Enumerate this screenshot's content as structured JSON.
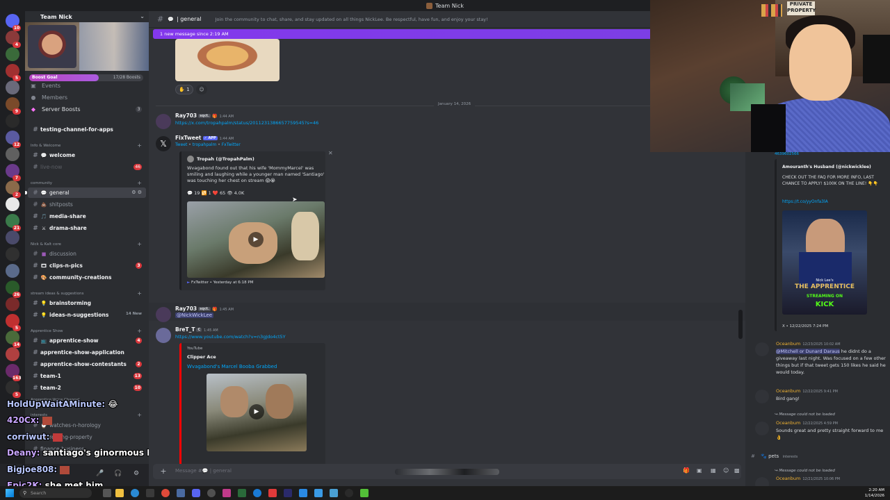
{
  "window": {
    "title": "Team Nick"
  },
  "server": {
    "name": "Team Nick",
    "boost": {
      "label": "Boost Goal",
      "count": "17/28 Boosts",
      "progress": 0.61
    }
  },
  "nav": {
    "events": "Events",
    "members": "Members",
    "server_boosts": "Server Boosts",
    "server_boosts_badge": "3"
  },
  "channels": {
    "testing": "testing-channel-for-apps",
    "cat_info": "Info & Welcome",
    "welcome": "welcome",
    "live_now": "live-now",
    "live_now_badge": "46",
    "cat_community": "community",
    "general": "general",
    "shitposts": "shitposts",
    "media_share": "media-share",
    "drama_share": "drama-share",
    "cat_nick": "Nick & Kalt core",
    "discussion": "discussion",
    "clips": "clips-n-pics",
    "clips_badge": "3",
    "community_creations": "community-creations",
    "cat_stream": "stream ideas & suggestions",
    "brainstorming": "brainstorming",
    "ideas": "ideas-n-suggestions",
    "ideas_new": "14 New",
    "cat_apprentice": "Apprentice Show",
    "apprentice_show": "apprentice-show",
    "apprentice_show_badge": "4",
    "apprentice_app": "apprentice-show-application",
    "apprentice_contestants": "apprentice-show-contestants",
    "apprentice_contestants_badge": "2",
    "team1": "team-1",
    "team1_badge": "13",
    "team2": "team-2",
    "team2_badge": "10",
    "cat_voice": "Apprentice Voice Channel",
    "cat_interests": "interests",
    "watches": "watches-n-horology",
    "property": "renting-property",
    "finance": "finance-business"
  },
  "rail_badges": [
    "10",
    "4",
    "5",
    "9",
    "12",
    "7",
    "2",
    "21",
    "26",
    "5",
    "14",
    "163",
    "5"
  ],
  "stream_overlay": [
    {
      "name": "HoldUpWaitAMinute:",
      "text": "😂"
    },
    {
      "name": "420Cx:",
      "text": ""
    },
    {
      "name": "corriwut:",
      "text": ""
    },
    {
      "name": "Deany:",
      "text": "santiago's ginormous BBC"
    },
    {
      "name": "Bigjoe808:",
      "text": ""
    },
    {
      "name": "Epic2K:",
      "text": "she met him"
    }
  ],
  "header": {
    "channel": "general",
    "topic": "Join the community to chat, share, and stay updated on all things NickLee. Be respectful, have fun, and enjoy your stay!",
    "new_messages": "1 new message since 2:19 AM"
  },
  "reactions": {
    "hand_count": "1"
  },
  "date_divider": "January 14, 2026",
  "messages": {
    "m1": {
      "user": "Ray703",
      "tag": "sqct.",
      "time": "1:44 AM",
      "link": "https://x.com/tropahpalm/status/2011231386657759545?s=46"
    },
    "m2": {
      "user": "FixTweet",
      "tag": "APP",
      "time": "1:44 AM",
      "sub_tweet": "Tweet",
      "sub_author": "tropahpalm",
      "sub_fx": "FxTwitter",
      "embed_author": "Tropah (@TropahPalm)",
      "embed_text": "Wvagabond found out that his wife 'MommyMarcel' was smiling and laughing while a younger man named 'Santiago' was touching her chest on stream 😱😭",
      "stats": "💬 19  🔁 1  ❤️ 65  👁 4.0K",
      "footer": "FxTwitter • Yesterday at 6:18 PM"
    },
    "m3": {
      "user": "Ray703",
      "tag": "sqct.",
      "time": "1:45 AM",
      "mention": "@NickWickLee"
    },
    "m4": {
      "user": "BreT_T",
      "tag": "C",
      "time": "1:45 AM",
      "link": "https://www.youtube.com/watch?v=n3gJdo4ct5Y",
      "provider": "YouTube",
      "channel": "Clipper Ace",
      "title": "Wvagabond's Marcel Booba Grabbed"
    }
  },
  "composer": {
    "placeholder": "Message #💬 | general"
  },
  "right": {
    "top_id": "4639602566",
    "card_name": "Amouranth's Husband (@nickwicklee)",
    "card_text": "CHECK OUT THE FAQ FOR MORE INFO, LAST CHANCE TO APPLY! $100K ON THE LINE! 👇👇",
    "card_link": "https://t.co/yyOnfa3lA",
    "card_footer": "X • 12/22/2025 7:24 PM",
    "poster_title": "THE APPRENTICE",
    "poster_sub": "STREAMING ON",
    "poster_kick": "KICK",
    "poster_name": "Nick Lee's",
    "r1": {
      "user": "Oceanbum",
      "time": "12/23/2025 10:02 AM",
      "mention": "@Mitchell or Dunard Daraus",
      "text": "he didnt do a giveaway last night. Was focused on a few other things but if that tweet gets 150 likes he said he would today."
    },
    "r2": {
      "user": "Oceanbum",
      "time": "12/22/2025 9:41 PM",
      "text": "Bird gang!"
    },
    "r3": {
      "sys": "Message could not be loaded",
      "user": "Oceanbum",
      "time": "12/22/2025 4:59 PM",
      "text": "Sounds great and pretty straight forward to me👌"
    },
    "r4_channel": "pets",
    "r4_cat": "interests",
    "r5": {
      "sys": "Message could not be loaded",
      "user": "Oceanbum",
      "time": "12/21/2025 10:06 PM"
    }
  },
  "taskbar": {
    "search": "Search",
    "time": "2:20 AM",
    "date": "1/14/2026"
  },
  "colors": {
    "accent": "#5865f2",
    "new_bar": "#8338ec",
    "link": "#00a8fc",
    "mention_user": "#f0b232"
  }
}
